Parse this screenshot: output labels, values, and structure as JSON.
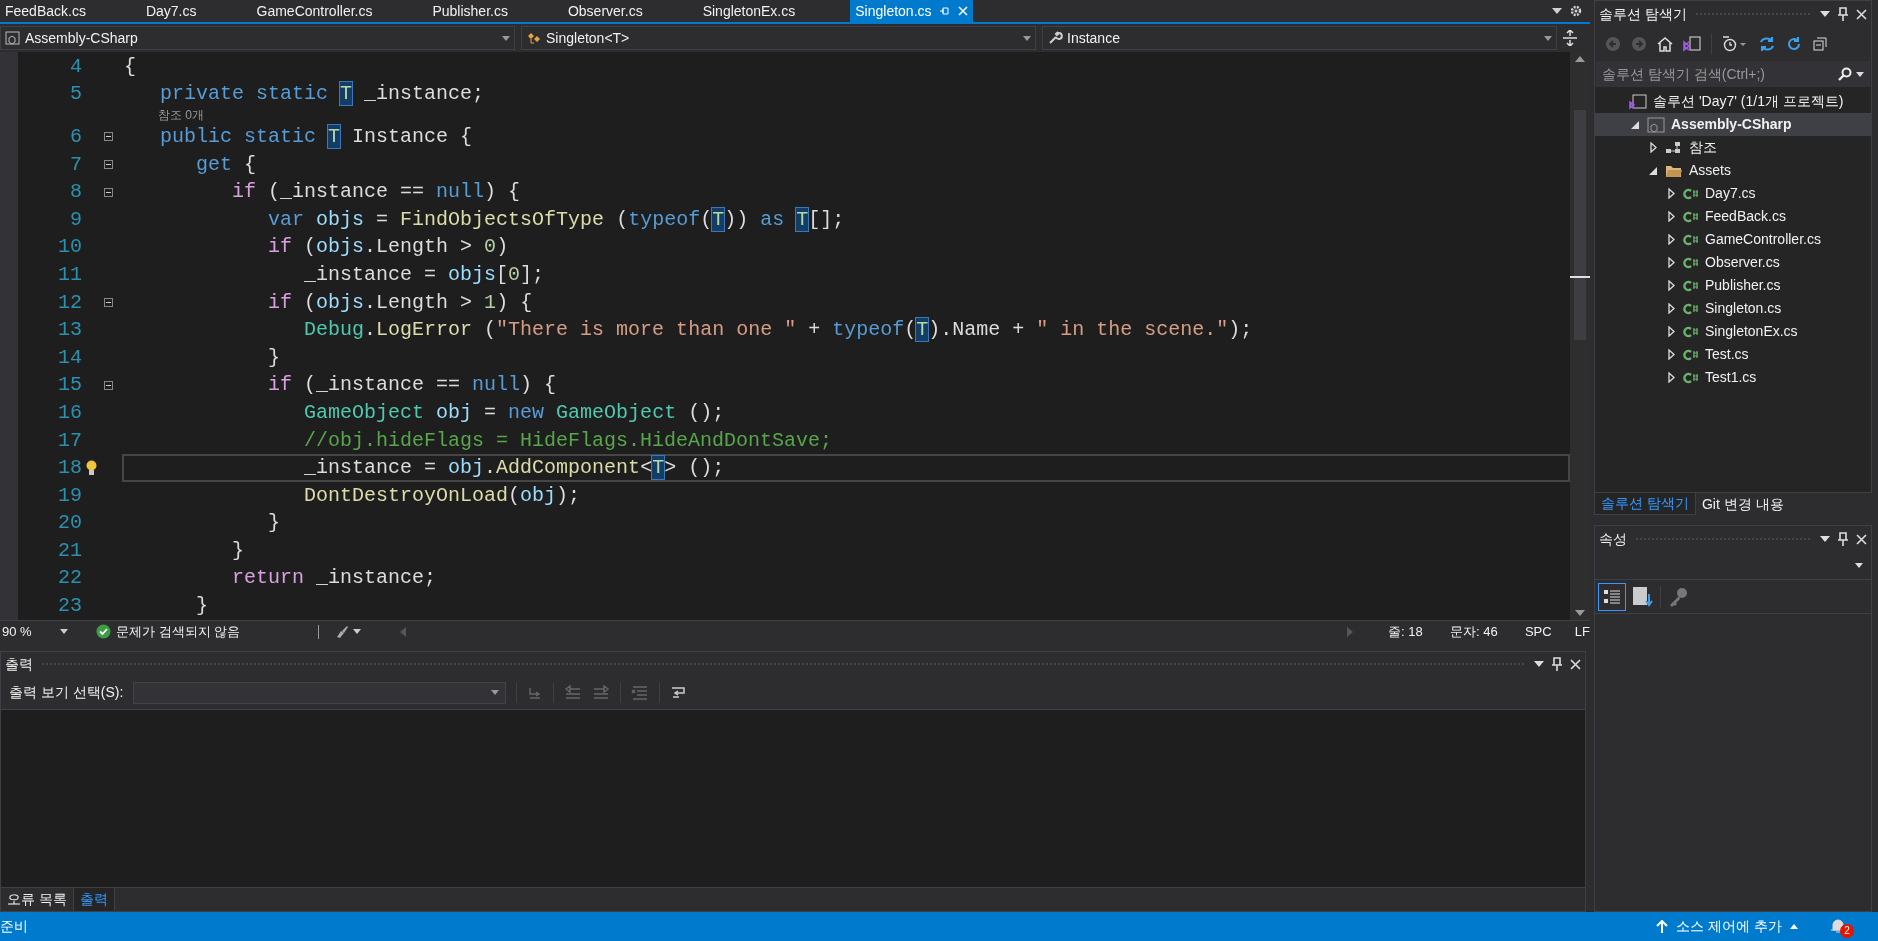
{
  "document_tabs": [
    {
      "label": "FeedBack.cs",
      "selected": false
    },
    {
      "label": "Day7.cs",
      "selected": false
    },
    {
      "label": "GameController.cs",
      "selected": false
    },
    {
      "label": "Publisher.cs",
      "selected": false
    },
    {
      "label": "Observer.cs",
      "selected": false
    },
    {
      "label": "SingletonEx.cs",
      "selected": false
    },
    {
      "label": "Singleton.cs",
      "selected": true
    }
  ],
  "navigation_bar": {
    "project": "Assembly-CSharp",
    "type": "Singleton<T>",
    "member": "Instance"
  },
  "editor": {
    "lines": [
      {
        "number": "4",
        "fold": false,
        "tokens": [
          {
            "kind": "plain",
            "text": "{"
          }
        ]
      },
      {
        "number": "5",
        "fold": false,
        "tokens": [
          {
            "kind": "keyword",
            "text": "   private static "
          },
          {
            "kind": "typeparam",
            "text": "T"
          },
          {
            "kind": "plain",
            "text": " _instance;"
          }
        ]
      },
      {
        "number": "6",
        "fold": true,
        "codelens": "참조 0개",
        "tokens": [
          {
            "kind": "keyword",
            "text": "   public static "
          },
          {
            "kind": "typeparam",
            "text": "T"
          },
          {
            "kind": "plain",
            "text": " Instance {"
          }
        ]
      },
      {
        "number": "7",
        "fold": true,
        "tokens": [
          {
            "kind": "keyword",
            "text": "      get"
          },
          {
            "kind": "plain",
            "text": " {"
          }
        ]
      },
      {
        "number": "8",
        "fold": true,
        "tokens": [
          {
            "kind": "control",
            "text": "         if"
          },
          {
            "kind": "plain",
            "text": " (_instance == "
          },
          {
            "kind": "keyword",
            "text": "null"
          },
          {
            "kind": "plain",
            "text": ") {"
          }
        ]
      },
      {
        "number": "9",
        "fold": false,
        "tokens": [
          {
            "kind": "keyword",
            "text": "            var "
          },
          {
            "kind": "variable",
            "text": "objs"
          },
          {
            "kind": "plain",
            "text": " = "
          },
          {
            "kind": "method",
            "text": "FindObjectsOfType"
          },
          {
            "kind": "plain",
            "text": " ("
          },
          {
            "kind": "keyword",
            "text": "typeof"
          },
          {
            "kind": "plain",
            "text": "("
          },
          {
            "kind": "typeparam",
            "text": "T"
          },
          {
            "kind": "plain",
            "text": ")) "
          },
          {
            "kind": "keyword",
            "text": "as "
          },
          {
            "kind": "typeparam",
            "text": "T"
          },
          {
            "kind": "plain",
            "text": "[];"
          }
        ]
      },
      {
        "number": "10",
        "fold": false,
        "tokens": [
          {
            "kind": "control",
            "text": "            if"
          },
          {
            "kind": "plain",
            "text": " ("
          },
          {
            "kind": "variable",
            "text": "objs"
          },
          {
            "kind": "plain",
            "text": ".Length > "
          },
          {
            "kind": "number",
            "text": "0"
          },
          {
            "kind": "plain",
            "text": ")"
          }
        ]
      },
      {
        "number": "11",
        "fold": false,
        "tokens": [
          {
            "kind": "plain",
            "text": "               _instance = "
          },
          {
            "kind": "variable",
            "text": "objs"
          },
          {
            "kind": "plain",
            "text": "["
          },
          {
            "kind": "number",
            "text": "0"
          },
          {
            "kind": "plain",
            "text": "];"
          }
        ]
      },
      {
        "number": "12",
        "fold": true,
        "tokens": [
          {
            "kind": "control",
            "text": "            if"
          },
          {
            "kind": "plain",
            "text": " ("
          },
          {
            "kind": "variable",
            "text": "objs"
          },
          {
            "kind": "plain",
            "text": ".Length > "
          },
          {
            "kind": "number",
            "text": "1"
          },
          {
            "kind": "plain",
            "text": ") {"
          }
        ]
      },
      {
        "number": "13",
        "fold": false,
        "tokens": [
          {
            "kind": "type",
            "text": "               Debug"
          },
          {
            "kind": "plain",
            "text": "."
          },
          {
            "kind": "method",
            "text": "LogError"
          },
          {
            "kind": "plain",
            "text": " ("
          },
          {
            "kind": "string",
            "text": "\"There is more than one \""
          },
          {
            "kind": "plain",
            "text": " + "
          },
          {
            "kind": "keyword",
            "text": "typeof"
          },
          {
            "kind": "plain",
            "text": "("
          },
          {
            "kind": "typeparam",
            "text": "T"
          },
          {
            "kind": "plain",
            "text": ").Name + "
          },
          {
            "kind": "string",
            "text": "\" in the scene.\""
          },
          {
            "kind": "plain",
            "text": ");"
          }
        ]
      },
      {
        "number": "14",
        "fold": false,
        "tokens": [
          {
            "kind": "plain",
            "text": "            }"
          }
        ]
      },
      {
        "number": "15",
        "fold": true,
        "tokens": [
          {
            "kind": "control",
            "text": "            if"
          },
          {
            "kind": "plain",
            "text": " (_instance == "
          },
          {
            "kind": "keyword",
            "text": "null"
          },
          {
            "kind": "plain",
            "text": ") {"
          }
        ]
      },
      {
        "number": "16",
        "fold": false,
        "tokens": [
          {
            "kind": "type",
            "text": "               GameObject "
          },
          {
            "kind": "variable",
            "text": "obj"
          },
          {
            "kind": "plain",
            "text": " = "
          },
          {
            "kind": "keyword",
            "text": "new "
          },
          {
            "kind": "type",
            "text": "GameObject"
          },
          {
            "kind": "plain",
            "text": " ();"
          }
        ]
      },
      {
        "number": "17",
        "fold": false,
        "tokens": [
          {
            "kind": "comment",
            "text": "               //obj.hideFlags = HideFlags.HideAndDontSave;"
          }
        ]
      },
      {
        "number": "18",
        "fold": false,
        "current": true,
        "lightbulb": true,
        "tokens": [
          {
            "kind": "plain",
            "text": "               _instance = "
          },
          {
            "kind": "variable",
            "text": "obj"
          },
          {
            "kind": "plain",
            "text": "."
          },
          {
            "kind": "method",
            "text": "AddComponent"
          },
          {
            "kind": "plain",
            "text": "<"
          },
          {
            "kind": "typeparam",
            "text": "T"
          },
          {
            "kind": "plain",
            "text": "> ();"
          }
        ]
      },
      {
        "number": "19",
        "fold": false,
        "tokens": [
          {
            "kind": "method",
            "text": "               DontDestroyOnLoad"
          },
          {
            "kind": "plain",
            "text": "("
          },
          {
            "kind": "variable",
            "text": "obj"
          },
          {
            "kind": "plain",
            "text": ");"
          }
        ]
      },
      {
        "number": "20",
        "fold": false,
        "tokens": [
          {
            "kind": "plain",
            "text": "            }"
          }
        ]
      },
      {
        "number": "21",
        "fold": false,
        "tokens": [
          {
            "kind": "plain",
            "text": "         }"
          }
        ]
      },
      {
        "number": "22",
        "fold": false,
        "tokens": [
          {
            "kind": "control",
            "text": "         return"
          },
          {
            "kind": "plain",
            "text": " _instance;"
          }
        ]
      },
      {
        "number": "23",
        "fold": false,
        "tokens": [
          {
            "kind": "plain",
            "text": "      }"
          }
        ]
      }
    ]
  },
  "editor_status": {
    "zoom": "90 %",
    "issues": "문제가 검색되지 않음",
    "line": "줄: 18",
    "column": "문자: 46",
    "whitespace": "SPC",
    "line_ending": "LF"
  },
  "output_panel": {
    "title": "출력",
    "source_label": "출력 보기 선택(S):"
  },
  "bottom_tabs": [
    {
      "label": "오류 목록",
      "selected": false
    },
    {
      "label": "출력",
      "selected": true
    }
  ],
  "solution_explorer": {
    "title": "솔루션 탐색기",
    "search": {
      "placeholder": "솔루션 탐색기 검색(Ctrl+;)"
    },
    "tree": [
      {
        "label": "솔루션 'Day7' (1/1개 프로젝트)",
        "kind": "solution",
        "selected": false,
        "children": [
          {
            "label": "Assembly-CSharp",
            "kind": "project",
            "selected": true,
            "expanded": true,
            "children": [
              {
                "label": "참조",
                "kind": "references",
                "selected": false,
                "expanded": false
              },
              {
                "label": "Assets",
                "kind": "folder",
                "selected": false,
                "expanded": true,
                "children": [
                  {
                    "label": "Day7.cs",
                    "kind": "file",
                    "selected": false,
                    "expanded": false
                  },
                  {
                    "label": "FeedBack.cs",
                    "kind": "file",
                    "selected": false,
                    "expanded": false
                  },
                  {
                    "label": "GameController.cs",
                    "kind": "file",
                    "selected": false,
                    "expanded": false
                  },
                  {
                    "label": "Observer.cs",
                    "kind": "file",
                    "selected": false,
                    "expanded": false
                  },
                  {
                    "label": "Publisher.cs",
                    "kind": "file",
                    "selected": false,
                    "expanded": false
                  },
                  {
                    "label": "Singleton.cs",
                    "kind": "file",
                    "selected": false,
                    "expanded": false
                  },
                  {
                    "label": "SingletonEx.cs",
                    "kind": "file",
                    "selected": false,
                    "expanded": false
                  },
                  {
                    "label": "Test.cs",
                    "kind": "file",
                    "selected": false,
                    "expanded": false
                  },
                  {
                    "label": "Test1.cs",
                    "kind": "file",
                    "selected": false,
                    "expanded": false
                  }
                ]
              }
            ]
          }
        ]
      }
    ]
  },
  "panel_tabs": [
    {
      "label": "솔루션 탐색기",
      "selected": true
    },
    {
      "label": "Git 변경 내용",
      "selected": false
    }
  ],
  "properties": {
    "title": "속성"
  },
  "status_bar": {
    "message": "준비",
    "source_control": "소스 제어에 추가",
    "notifications": "2"
  }
}
